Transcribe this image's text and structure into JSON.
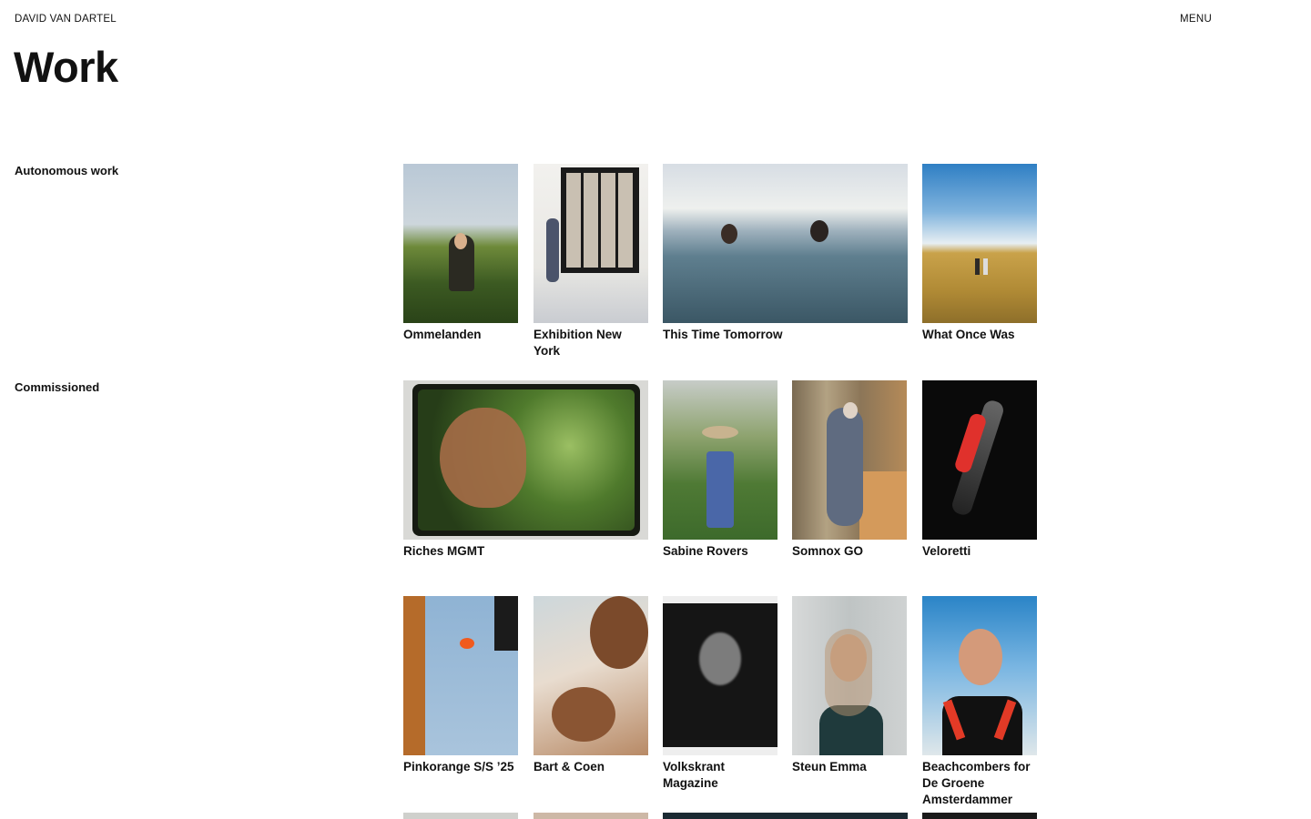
{
  "header": {
    "site_name": "DAVID VAN DARTEL",
    "menu_label": "MENU"
  },
  "page": {
    "title": "Work"
  },
  "sections": {
    "autonomous": {
      "label": "Autonomous work",
      "items": [
        {
          "title": "Ommelanden"
        },
        {
          "title": "Exhibition New York"
        },
        {
          "title": "This Time Tomorrow"
        },
        {
          "title": "What Once Was"
        }
      ]
    },
    "commissioned": {
      "label": "Commissioned",
      "row1": [
        {
          "title": "Riches MGMT"
        },
        {
          "title": "Sabine Rovers"
        },
        {
          "title": "Somnox GO"
        },
        {
          "title": "Veloretti"
        }
      ],
      "row2": [
        {
          "title": "Pinkorange S/S ’25"
        },
        {
          "title": "Bart & Coen"
        },
        {
          "title": "Volkskrant Magazine"
        },
        {
          "title": "Steun Emma"
        },
        {
          "title": "Beachcombers for De Groene Amsterdammer"
        }
      ]
    }
  }
}
